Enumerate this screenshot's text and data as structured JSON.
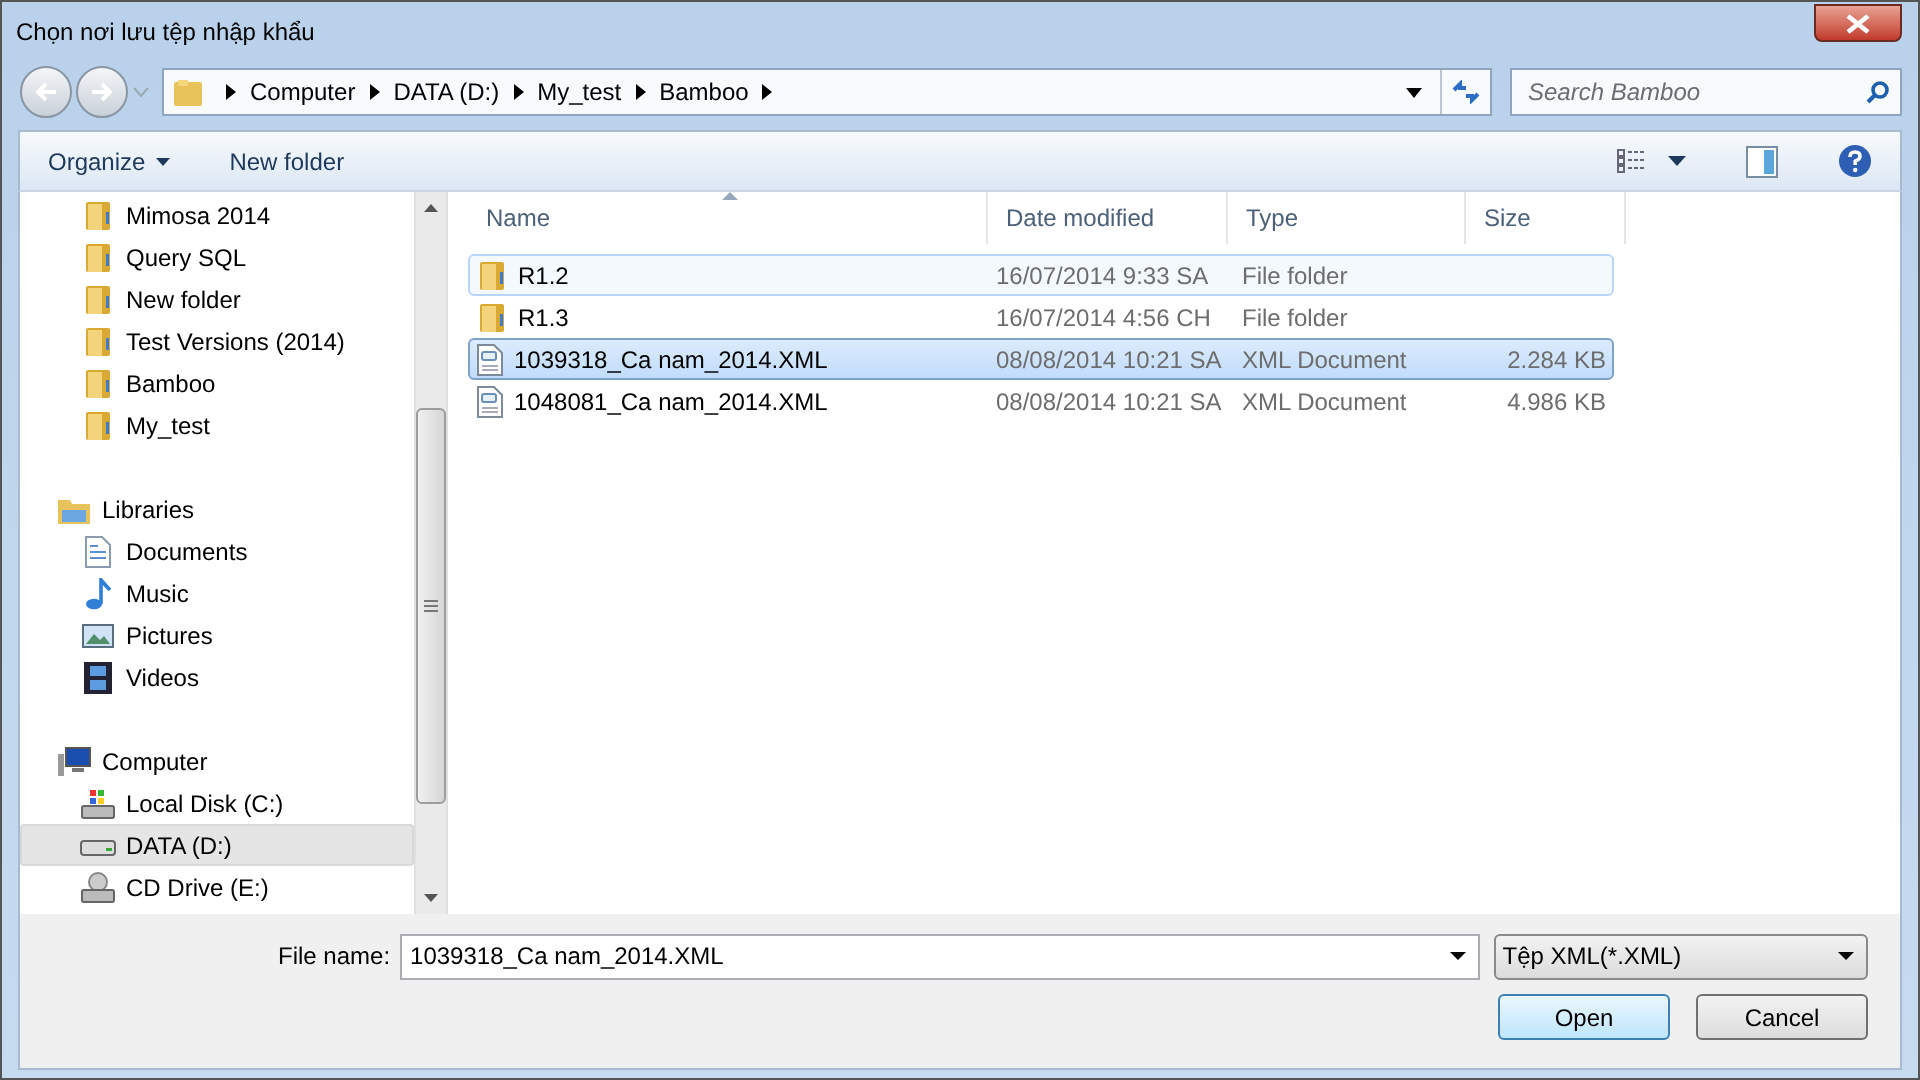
{
  "window": {
    "title": "Chọn nơi lưu tệp nhập khẩu"
  },
  "address": {
    "crumbs": [
      "Computer",
      "DATA (D:)",
      "My_test",
      "Bamboo"
    ]
  },
  "search": {
    "placeholder": "Search Bamboo"
  },
  "toolbar": {
    "organize": "Organize",
    "new_folder": "New folder"
  },
  "nav": {
    "groups": [
      {
        "items": [
          {
            "label": "Mimosa 2014",
            "kind": "folder",
            "selected": false
          },
          {
            "label": "Query SQL",
            "kind": "folder",
            "selected": false
          },
          {
            "label": "New folder",
            "kind": "folder",
            "selected": false
          },
          {
            "label": "Test Versions (2014)",
            "kind": "folder",
            "selected": false
          },
          {
            "label": "Bamboo",
            "kind": "folder",
            "selected": false
          },
          {
            "label": "My_test",
            "kind": "folder",
            "selected": false
          }
        ]
      },
      {
        "label": "Libraries",
        "kind": "library",
        "items": [
          {
            "label": "Documents",
            "kind": "documents",
            "selected": false
          },
          {
            "label": "Music",
            "kind": "music",
            "selected": false
          },
          {
            "label": "Pictures",
            "kind": "pictures",
            "selected": false
          },
          {
            "label": "Videos",
            "kind": "videos",
            "selected": false
          }
        ]
      },
      {
        "label": "Computer",
        "kind": "computer",
        "items": [
          {
            "label": "Local Disk (C:)",
            "kind": "system_disk",
            "selected": false
          },
          {
            "label": "DATA (D:)",
            "kind": "disk",
            "selected": true
          },
          {
            "label": "CD Drive (E:)",
            "kind": "cd",
            "selected": false
          }
        ]
      }
    ]
  },
  "table": {
    "columns": [
      "Name",
      "Date modified",
      "Type",
      "Size"
    ],
    "rows": [
      {
        "name": "R1.2",
        "kind": "folder",
        "date": "16/07/2014 9:33 SA",
        "type": "File folder",
        "size": "",
        "selected": false,
        "hovered": true
      },
      {
        "name": "R1.3",
        "kind": "folder",
        "date": "16/07/2014 4:56 CH",
        "type": "File folder",
        "size": "",
        "selected": false,
        "hovered": false
      },
      {
        "name": "1039318_Ca nam_2014.XML",
        "kind": "xml",
        "date": "08/08/2014 10:21 SA",
        "type": "XML Document",
        "size": "2.284 KB",
        "selected": true,
        "hovered": false
      },
      {
        "name": "1048081_Ca nam_2014.XML",
        "kind": "xml",
        "date": "08/08/2014 10:21 SA",
        "type": "XML Document",
        "size": "4.986 KB",
        "selected": false,
        "hovered": false
      }
    ]
  },
  "footer": {
    "file_name_label": "File name:",
    "file_name": "1039318_Ca nam_2014.XML",
    "file_type": "Tệp XML(*.XML)",
    "buttons": [
      "Open",
      "Cancel"
    ]
  }
}
